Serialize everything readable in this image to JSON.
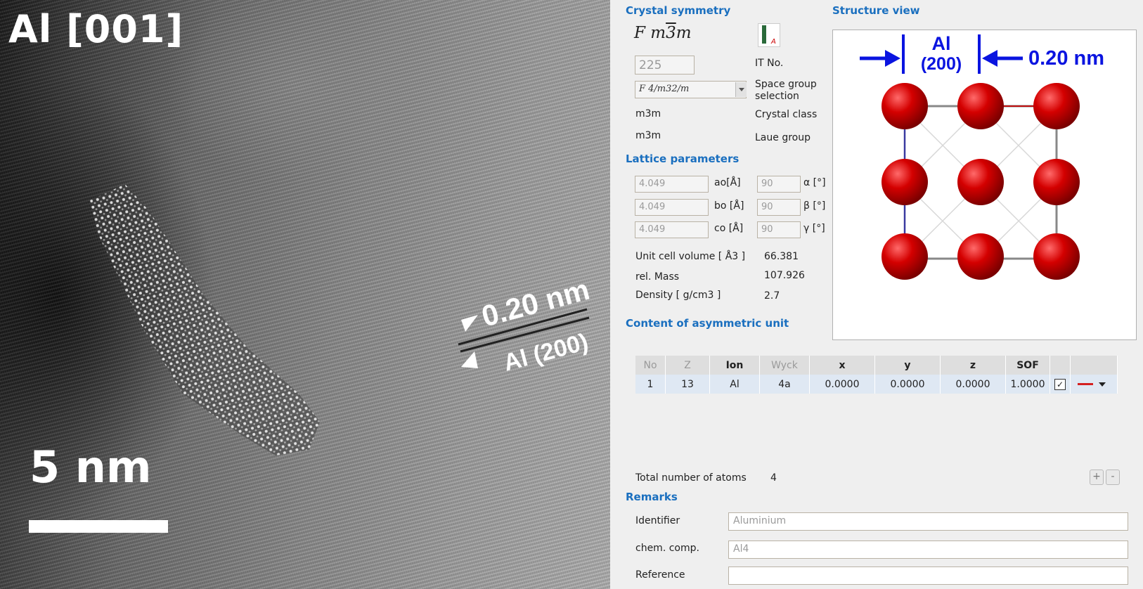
{
  "tem_image": {
    "title": "Al [001]",
    "scale_label": "5 nm",
    "spacing_label": "0.20 nm",
    "plane_label": "Al (200)"
  },
  "crystal_symmetry": {
    "heading": "Crystal symmetry",
    "space_group_symbol": "F m3m",
    "it_no_value": "225",
    "it_no_label": "IT No.",
    "space_group_selection_value": "F 4/m32/m",
    "space_group_selection_label": "Space group selection",
    "crystal_class_value": "m3m",
    "crystal_class_label": "Crystal class",
    "laue_group_value": "m3m",
    "laue_group_label": "Laue group"
  },
  "lattice": {
    "heading": "Lattice parameters",
    "a_value": "4.049",
    "a_label": "ao[Å]",
    "b_value": "4.049",
    "b_label": "bo [Å]",
    "c_value": "4.049",
    "c_label": "co [Å]",
    "alpha_value": "90",
    "alpha_label": "α [°]",
    "beta_value": "90",
    "beta_label": "β [°]",
    "gamma_value": "90",
    "gamma_label": "γ [°]",
    "volume_label": "Unit cell volume [ Å3 ]",
    "volume_value": "66.381",
    "mass_label": "rel. Mass",
    "mass_value": "107.926",
    "density_label": "Density [ g/cm3 ]",
    "density_value": "2.7"
  },
  "structure_view": {
    "heading": "Structure view",
    "element_label": "Al",
    "plane_label": "(200)",
    "spacing_label": "0.20 nm",
    "atom_color": "#d40000",
    "annotation_color": "#0a14e0"
  },
  "asym_unit": {
    "heading": "Content of asymmetric unit",
    "columns": [
      "No",
      "Z",
      "Ion",
      "Wyck",
      "x",
      "y",
      "z",
      "SOF"
    ],
    "rows": [
      {
        "no": "1",
        "z_num": "13",
        "ion": "Al",
        "wyck": "4a",
        "x": "0.0000",
        "y": "0.0000",
        "z": "0.0000",
        "sof": "1.0000",
        "checked": "✓"
      }
    ],
    "total_atoms_label": "Total number of atoms",
    "total_atoms_value": "4",
    "add_label": "+",
    "remove_label": "-"
  },
  "remarks": {
    "heading": "Remarks",
    "identifier_label": "Identifier",
    "identifier_value": "Aluminium",
    "chem_comp_label": "chem. comp.",
    "chem_comp_value": "Al4",
    "reference_label": "Reference",
    "reference_value": ""
  }
}
